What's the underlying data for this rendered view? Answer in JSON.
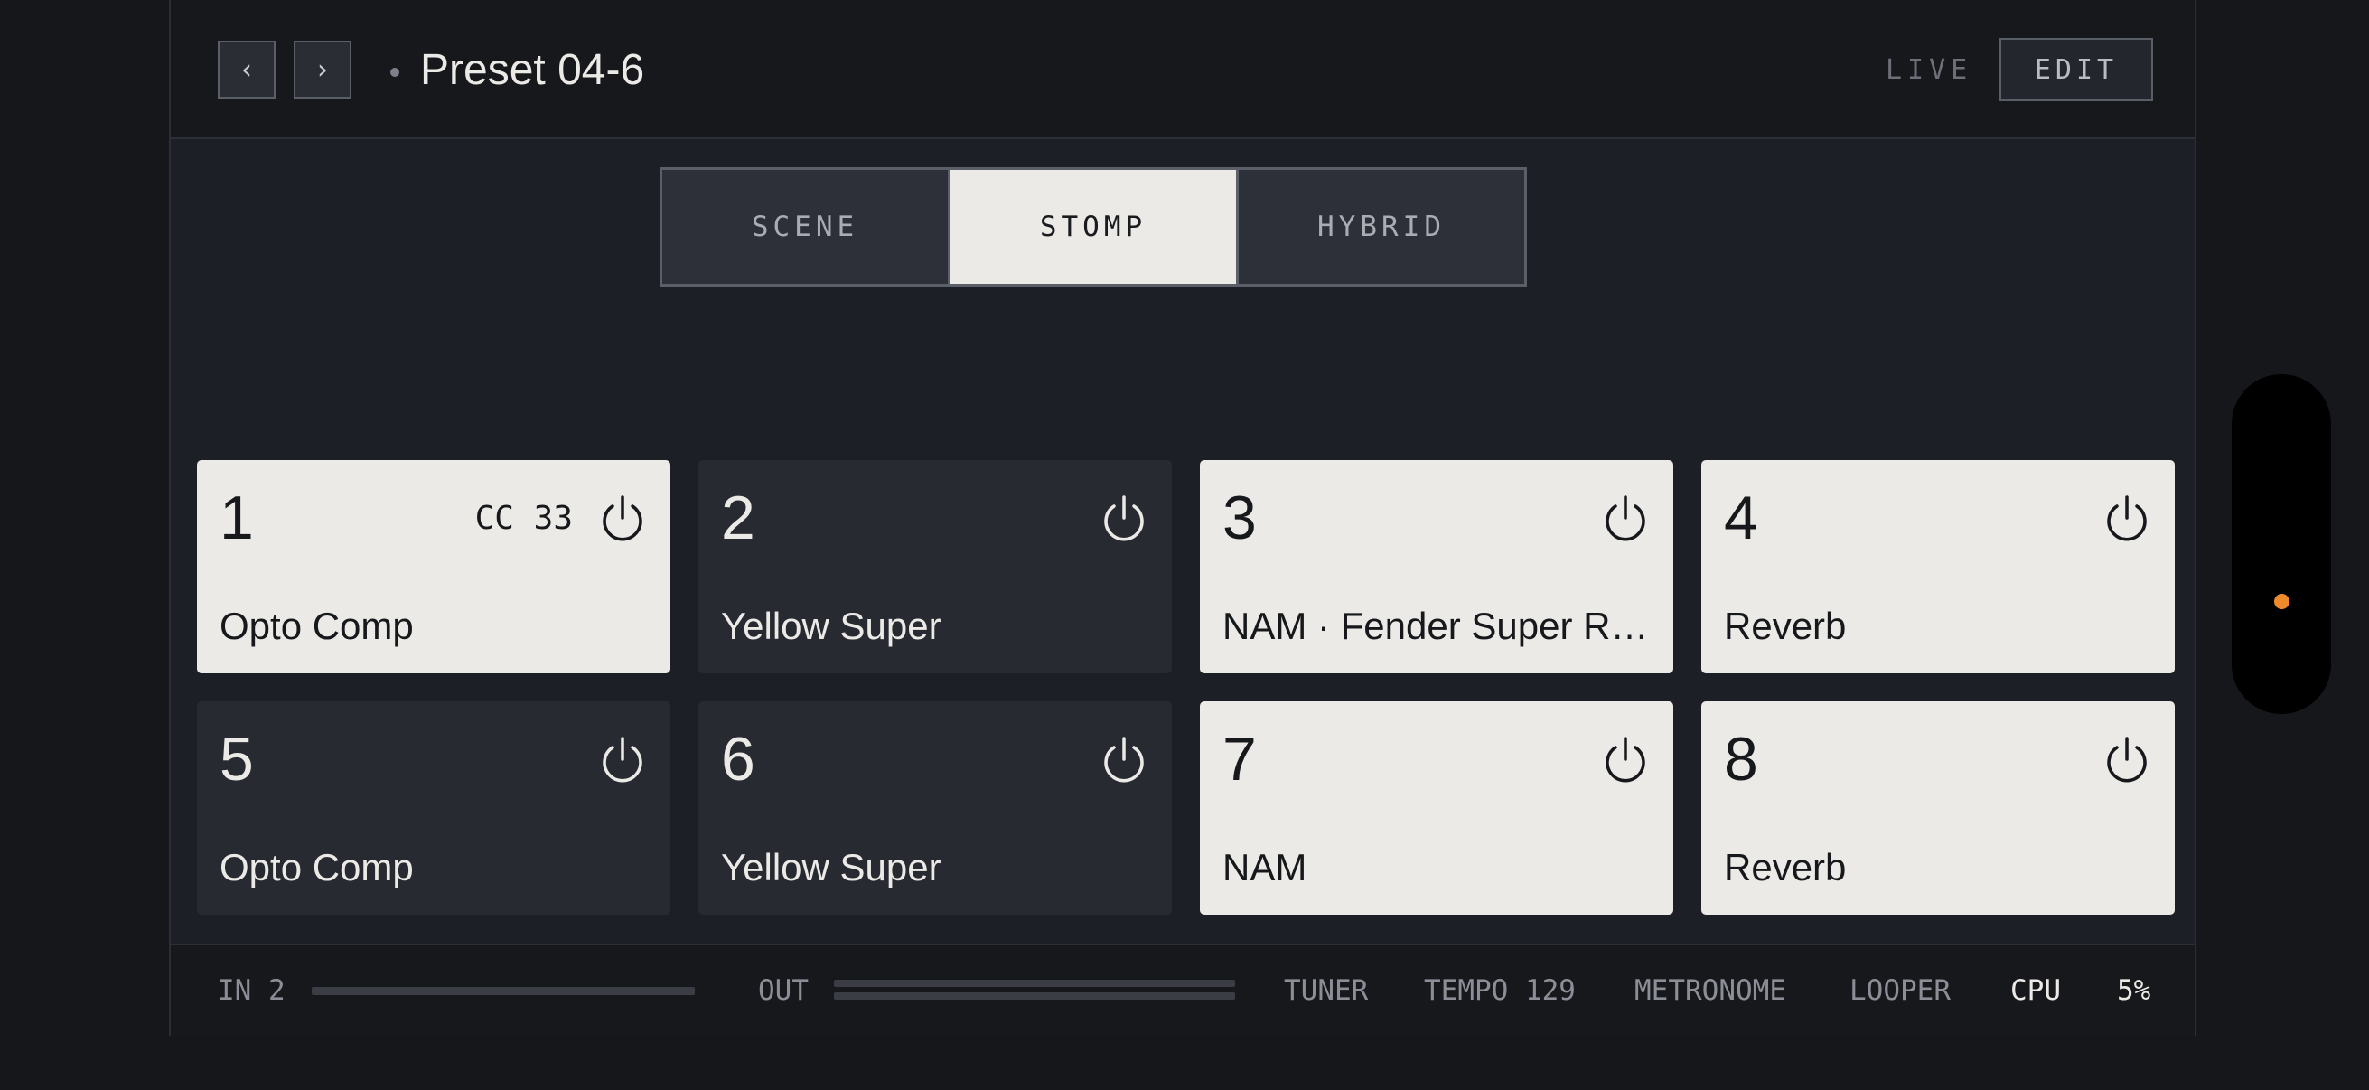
{
  "header": {
    "prev_label": "‹",
    "next_label": "›",
    "preset_name": "Preset 04-6",
    "live_label": "LIVE",
    "edit_label": "EDIT"
  },
  "modes": [
    {
      "label": "SCENE",
      "active": false
    },
    {
      "label": "STOMP",
      "active": true
    },
    {
      "label": "HYBRID",
      "active": false
    }
  ],
  "stomps": [
    {
      "number": "1",
      "name": "Opto Comp",
      "cc": "CC 33",
      "on": true,
      "icon": "power-icon"
    },
    {
      "number": "2",
      "name": "Yellow Super",
      "cc": "",
      "on": false,
      "icon": "power-icon"
    },
    {
      "number": "3",
      "name": "NAM · Fender Super Reverb",
      "cc": "",
      "on": true,
      "icon": "power-icon"
    },
    {
      "number": "4",
      "name": "Reverb",
      "cc": "",
      "on": true,
      "icon": "power-icon"
    },
    {
      "number": "5",
      "name": "Opto Comp",
      "cc": "",
      "on": false,
      "icon": "power-icon"
    },
    {
      "number": "6",
      "name": "Yellow Super",
      "cc": "",
      "on": false,
      "icon": "power-icon"
    },
    {
      "number": "7",
      "name": "NAM",
      "cc": "",
      "on": true,
      "icon": "power-icon"
    },
    {
      "number": "8",
      "name": "Reverb",
      "cc": "",
      "on": true,
      "icon": "power-icon"
    }
  ],
  "footer": {
    "in_label": "IN 2",
    "in_level": 0,
    "out_label": "OUT",
    "out_level_l": 0,
    "out_level_r": 0,
    "tuner_label": "TUNER",
    "tempo_label": "TEMPO 129",
    "metronome_label": "METRONOME",
    "looper_label": "LOOPER",
    "cpu_label": "CPU",
    "cpu_value": "5%"
  },
  "colors": {
    "background": "#16171b",
    "card_on": "#ebeae6",
    "card_off": "#272a31",
    "side_indicator": "#ee8a2b"
  }
}
